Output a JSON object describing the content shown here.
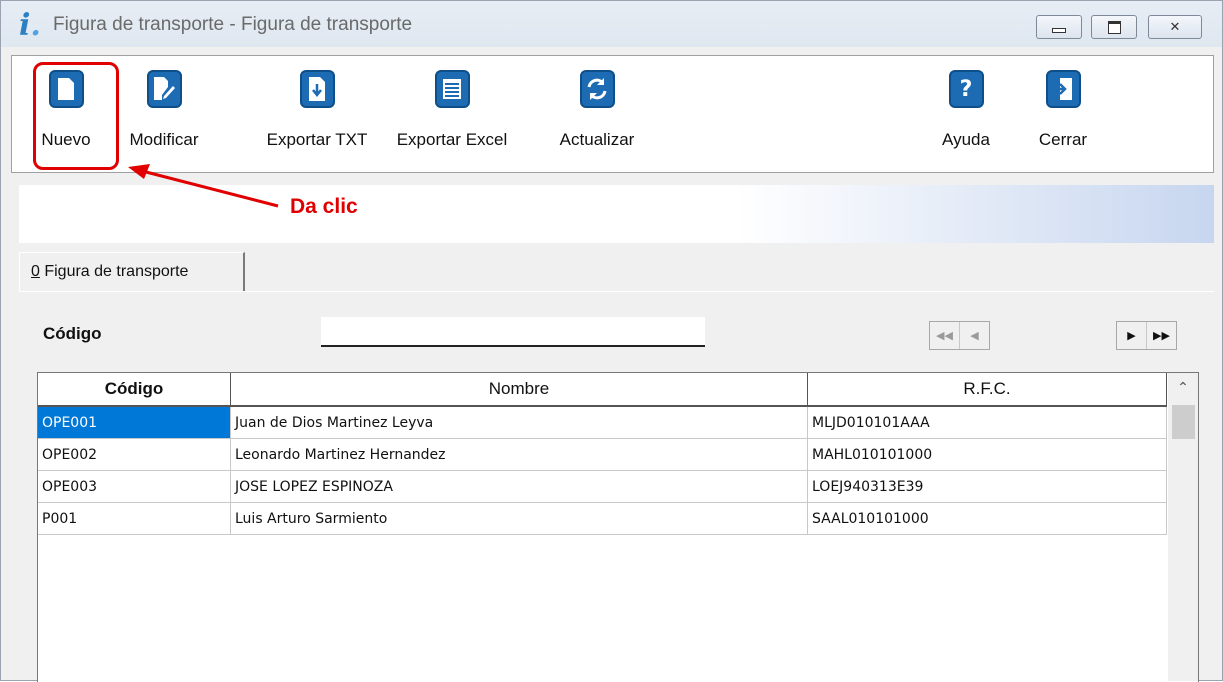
{
  "window": {
    "title": "Figura de transporte - Figura de transporte",
    "close_glyph": "✕"
  },
  "toolbar": {
    "buttons": [
      {
        "label": "Nuevo",
        "icon": "new-document-icon"
      },
      {
        "label": "Modificar",
        "icon": "edit-document-icon"
      },
      {
        "label": "Exportar TXT",
        "icon": "export-txt-icon"
      },
      {
        "label": "Exportar Excel",
        "icon": "export-excel-icon"
      },
      {
        "label": "Actualizar",
        "icon": "refresh-icon"
      },
      {
        "label": "Ayuda",
        "icon": "help-icon"
      },
      {
        "label": "Cerrar",
        "icon": "exit-door-icon"
      }
    ]
  },
  "annotation": {
    "text": "Da clic",
    "color": "#e00000"
  },
  "tab": {
    "hotkey": "0",
    "label": " Figura de transporte"
  },
  "filter": {
    "label": "Código",
    "value": ""
  },
  "grid": {
    "columns": [
      "Código",
      "Nombre",
      "R.F.C."
    ],
    "rows": [
      {
        "codigo": "OPE001",
        "nombre": "Juan de Dios Martinez Leyva",
        "rfc": "MLJD010101AAA"
      },
      {
        "codigo": "OPE002",
        "nombre": "Leonardo Martinez Hernandez",
        "rfc": "MAHL010101000"
      },
      {
        "codigo": "OPE003",
        "nombre": "JOSE LOPEZ ESPINOZA",
        "rfc": "LOEJ940313E39"
      },
      {
        "codigo": "P001",
        "nombre": "Luis Arturo Sarmiento",
        "rfc": "SAAL010101000"
      }
    ]
  },
  "colors": {
    "accent": "#0078d7",
    "icon_blue": "#1c6bb3"
  }
}
